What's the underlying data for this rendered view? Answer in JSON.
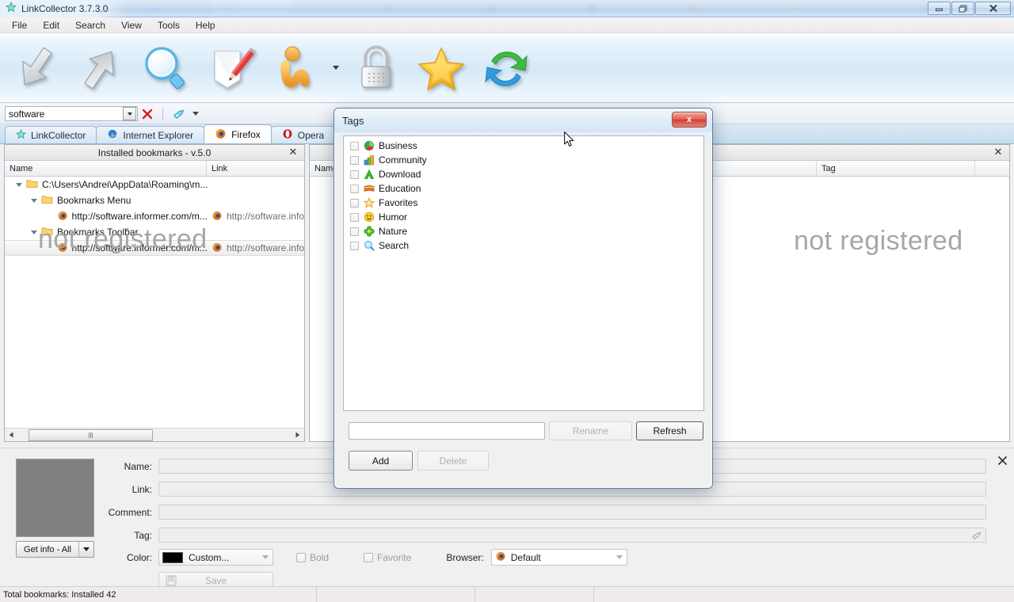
{
  "window": {
    "title": "LinkCollector 3.7.3.0",
    "icon": "star-icon",
    "buttons": {
      "minimize": "–",
      "restore": "❐",
      "close": "✕"
    }
  },
  "menu": {
    "items": [
      "File",
      "Edit",
      "Search",
      "View",
      "Tools",
      "Help"
    ]
  },
  "toolbar": {
    "items": [
      {
        "name": "import-arrow-down-icon",
        "icon": "arrow-down-gray"
      },
      {
        "name": "export-arrow-up-icon",
        "icon": "arrow-up-gray"
      },
      {
        "name": "search-magnifier-icon",
        "icon": "magnifier"
      },
      {
        "name": "edit-note-pencil-icon",
        "icon": "note-pencil"
      },
      {
        "name": "user-profile-icon",
        "icon": "person-orange"
      },
      {
        "name": "lock-icon",
        "icon": "padlock"
      },
      {
        "name": "favorites-star-icon",
        "icon": "star-yellow"
      },
      {
        "name": "refresh-sync-icon",
        "icon": "sync-arrows"
      }
    ]
  },
  "search": {
    "value": "software",
    "placeholder": "",
    "clear_label": "✕",
    "tag_icon": "tag-icon"
  },
  "tabs": [
    {
      "label": "LinkCollector",
      "icon": "star-icon",
      "active": false
    },
    {
      "label": "Internet Explorer",
      "icon": "ie-icon",
      "active": false
    },
    {
      "label": "Firefox",
      "icon": "firefox-icon",
      "active": true
    },
    {
      "label": "Opera",
      "icon": "opera-icon",
      "active": false
    }
  ],
  "left_panel": {
    "header": "Installed bookmarks - v.5.0",
    "close_label": "✕",
    "columns": [
      "Name",
      "Link"
    ],
    "watermark": "not registered",
    "rows": [
      {
        "indent": 0,
        "expander": true,
        "icon": "folder-icon",
        "name": "C:\\Users\\Andrei\\AppData\\Roaming\\m...",
        "link": "",
        "selected": false
      },
      {
        "indent": 1,
        "expander": true,
        "icon": "folder-icon",
        "name": "Bookmarks Menu",
        "link": "",
        "selected": false
      },
      {
        "indent": 2,
        "expander": false,
        "icon": "firefox-icon",
        "name": "http://software.informer.com/m...",
        "link": "http://software.info",
        "selected": false
      },
      {
        "indent": 1,
        "expander": true,
        "icon": "folder-icon",
        "name": "Bookmarks Toolbar",
        "link": "",
        "selected": false
      },
      {
        "indent": 2,
        "expander": false,
        "icon": "firefox-icon",
        "name": "http://software.informer.com/m...",
        "link": "http://software.info",
        "selected": true
      }
    ]
  },
  "middle_panel": {
    "columns": [
      "Name"
    ]
  },
  "right_panel": {
    "close_label": "✕",
    "columns": [
      "Tag"
    ],
    "watermark": "not registered"
  },
  "dialog": {
    "title": "Tags",
    "close_label": "x",
    "tags": [
      {
        "label": "Business",
        "icon": "pie-chart-icon",
        "checked": false
      },
      {
        "label": "Community",
        "icon": "community-icon",
        "checked": false
      },
      {
        "label": "Download",
        "icon": "download-icon",
        "checked": false
      },
      {
        "label": "Education",
        "icon": "book-icon",
        "checked": false
      },
      {
        "label": "Favorites",
        "icon": "star-icon",
        "checked": false
      },
      {
        "label": "Humor",
        "icon": "smiley-icon",
        "checked": false
      },
      {
        "label": "Nature",
        "icon": "flower-icon",
        "checked": false
      },
      {
        "label": "Search",
        "icon": "magnifier-icon",
        "checked": false
      }
    ],
    "input": {
      "value": "",
      "placeholder": ""
    },
    "buttons": {
      "rename": {
        "label": "Rename",
        "enabled": false
      },
      "refresh": {
        "label": "Refresh",
        "enabled": true
      },
      "add": {
        "label": "Add",
        "enabled": true
      },
      "delete": {
        "label": "Delete",
        "enabled": false
      }
    }
  },
  "form": {
    "thumbnail": "empty-thumbnail",
    "get_info": {
      "label": "Get info - All"
    },
    "fields": [
      {
        "label": "Name:",
        "value": ""
      },
      {
        "label": "Link:",
        "value": ""
      },
      {
        "label": "Comment:",
        "value": ""
      },
      {
        "label": "Tag:",
        "value": ""
      }
    ],
    "color": {
      "label": "Color:",
      "value": "Custom...",
      "swatch": "#000000"
    },
    "bold": {
      "label": "Bold",
      "checked": false
    },
    "favorite": {
      "label": "Favorite",
      "checked": false
    },
    "browser": {
      "label": "Browser:",
      "value": "Default",
      "icon": "firefox-icon"
    },
    "save": {
      "label": "Save",
      "enabled": false
    }
  },
  "statusbar": {
    "cells": [
      "Total bookmarks:  Installed 42",
      "",
      "",
      ""
    ]
  }
}
